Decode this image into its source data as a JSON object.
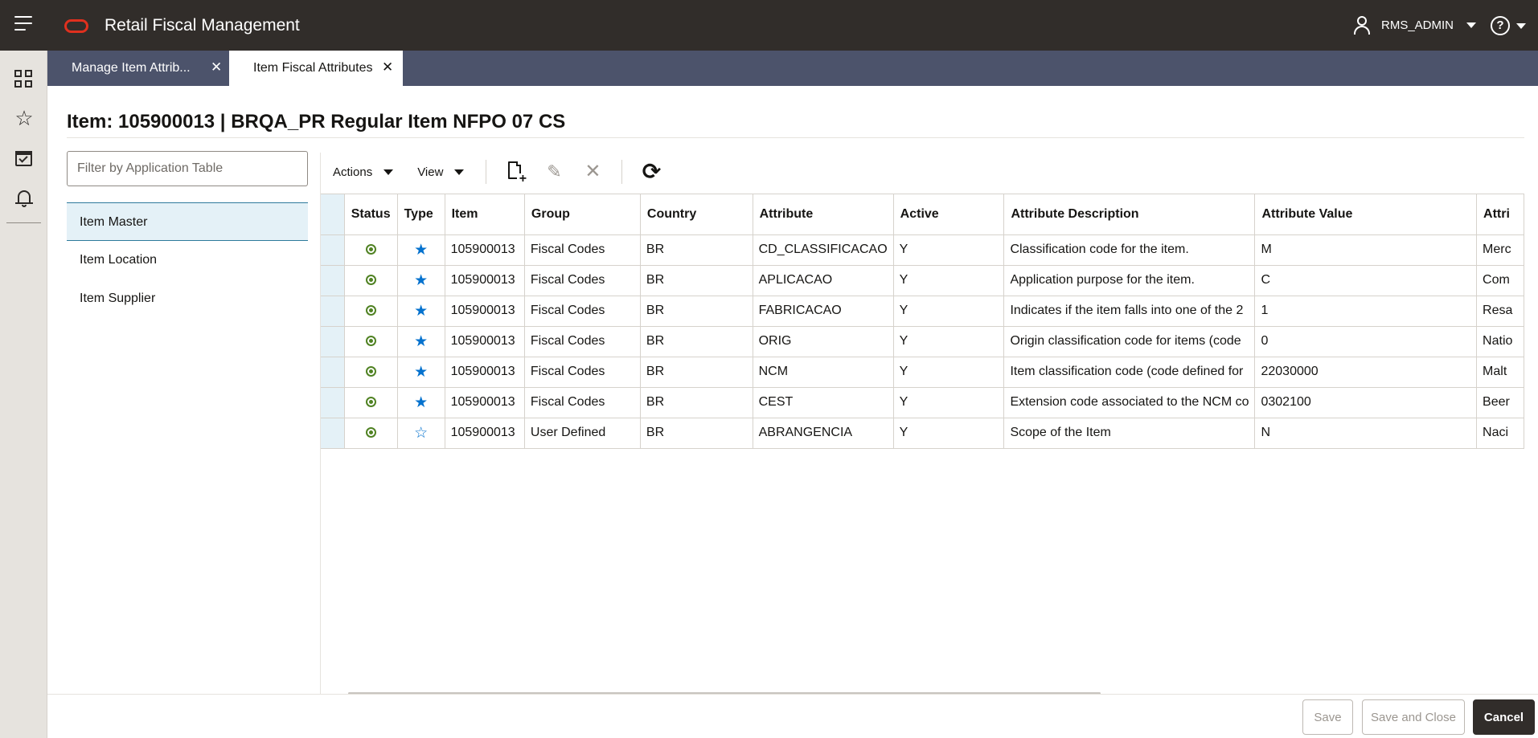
{
  "header": {
    "app_title": "Retail Fiscal Management",
    "user_name": "RMS_ADMIN",
    "help_glyph": "?"
  },
  "tabs": [
    {
      "label": "Manage Item Attrib...",
      "active": false
    },
    {
      "label": "Item Fiscal Attributes",
      "active": true
    }
  ],
  "page": {
    "title": "Item: 105900013 | BRQA_PR Regular Item NFPO 07 CS"
  },
  "filter": {
    "placeholder": "Filter by Application Table",
    "value": ""
  },
  "tree": {
    "items": [
      {
        "label": "Item Master",
        "selected": true
      },
      {
        "label": "Item Location",
        "selected": false
      },
      {
        "label": "Item Supplier",
        "selected": false
      }
    ]
  },
  "toolbar": {
    "actions_label": "Actions",
    "view_label": "View"
  },
  "table": {
    "columns": [
      "Status",
      "Type",
      "Item",
      "Group",
      "Country",
      "Attribute",
      "Active",
      "Attribute Description",
      "Attribute Value",
      "Attri"
    ],
    "rows": [
      {
        "item": "105900013",
        "group": "Fiscal Codes",
        "country": "BR",
        "attribute": "CD_CLASSIFICACAO",
        "active": "Y",
        "description": "Classification code for the item.",
        "value": "M",
        "extra": "Merc",
        "type_filled": true
      },
      {
        "item": "105900013",
        "group": "Fiscal Codes",
        "country": "BR",
        "attribute": "APLICACAO",
        "active": "Y",
        "description": "Application purpose for the item.",
        "value": "C",
        "extra": "Com",
        "type_filled": true
      },
      {
        "item": "105900013",
        "group": "Fiscal Codes",
        "country": "BR",
        "attribute": "FABRICACAO",
        "active": "Y",
        "description": "Indicates if the item falls into one of the 2",
        "value": "1",
        "extra": "Resa",
        "type_filled": true
      },
      {
        "item": "105900013",
        "group": "Fiscal Codes",
        "country": "BR",
        "attribute": "ORIG",
        "active": "Y",
        "description": "Origin classification code for items (code",
        "value": "0",
        "extra": "Natio",
        "type_filled": true
      },
      {
        "item": "105900013",
        "group": "Fiscal Codes",
        "country": "BR",
        "attribute": "NCM",
        "active": "Y",
        "description": "Item classification code (code defined for",
        "value": "22030000",
        "extra": "Malt",
        "type_filled": true
      },
      {
        "item": "105900013",
        "group": "Fiscal Codes",
        "country": "BR",
        "attribute": "CEST",
        "active": "Y",
        "description": "Extension code associated to the NCM co",
        "value": "0302100",
        "extra": "Beer",
        "type_filled": true
      },
      {
        "item": "105900013",
        "group": "User Defined",
        "country": "BR",
        "attribute": "ABRANGENCIA",
        "active": "Y",
        "description": "Scope of the Item",
        "value": "N",
        "extra": "Naci",
        "type_filled": false
      }
    ]
  },
  "footer": {
    "save_label": "Save",
    "save_close_label": "Save and Close",
    "cancel_label": "Cancel"
  },
  "colors": {
    "header_bg": "#312d2a",
    "tabbar_bg": "#4c536b",
    "selected_bg": "#e4f1f7",
    "status_green": "#508223",
    "star_blue": "#0572ce",
    "logo_red": "#e0301e"
  }
}
